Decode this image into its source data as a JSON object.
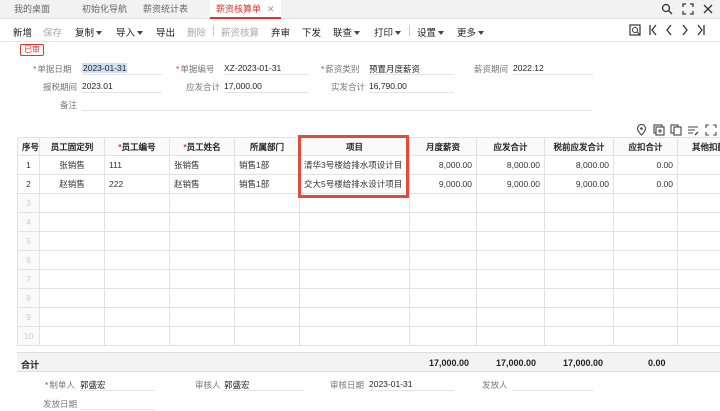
{
  "tabs": [
    {
      "label": "我的桌面"
    },
    {
      "label": "初始化导航"
    },
    {
      "label": "薪资统计表"
    },
    {
      "label": "薪资核算单"
    }
  ],
  "toolbar": {
    "add": "新增",
    "save": "保存",
    "copy": "复制",
    "import": "导入",
    "export": "导出",
    "delete": "删除",
    "calc": "薪资核算",
    "abandon": "弃审",
    "issue": "下发",
    "link": "联查",
    "print": "打印",
    "settings": "设置",
    "more": "更多"
  },
  "status_badge": "已审",
  "form": {
    "doc_date_label": "单据日期",
    "doc_date": "2023-01-31",
    "doc_no_label": "单据编号",
    "doc_no": "XZ-2023-01-31",
    "salary_type_label": "薪资类别",
    "salary_type": "预置月度薪资",
    "salary_period_label": "薪资期间",
    "salary_period": "2022.12",
    "tax_period_label": "报税期间",
    "tax_period": "2023.01",
    "gross_total_label": "应发合计",
    "gross_total": "17,000.00",
    "net_total_label": "实发合计",
    "net_total": "16,790.00",
    "remark_label": "备注"
  },
  "table": {
    "headers": [
      "序号",
      "员工固定列",
      "员工编号",
      "员工姓名",
      "所属部门",
      "项目",
      "月度薪资",
      "应发合计",
      "税前应发合计",
      "应扣合计",
      "其他扣款"
    ],
    "rows": [
      [
        "1",
        "张销售",
        "111",
        "张销售",
        "销售1部",
        "清华3号楼给排水项设计目",
        "8,000.00",
        "8,000.00",
        "8,000.00",
        "0.00",
        ""
      ],
      [
        "2",
        "赵销售",
        "222",
        "赵销售",
        "销售1部",
        "交大5号楼给排水设计项目",
        "9,000.00",
        "9,000.00",
        "9,000.00",
        "0.00",
        ""
      ]
    ],
    "empty_rows": [
      "3",
      "4",
      "5",
      "6",
      "7",
      "8",
      "9",
      "10"
    ],
    "total_label": "合计",
    "totals": {
      "monthly": "17,000.00",
      "gross": "17,000.00",
      "pretax": "17,000.00",
      "deduct": "0.00"
    }
  },
  "footer": {
    "maker_label": "制单人",
    "maker": "郭盛宏",
    "auditor_label": "审核人",
    "auditor": "郭盛宏",
    "audit_date_label": "审核日期",
    "audit_date": "2023-01-31",
    "issuer_label": "发放人",
    "issue_date_label": "发放日期"
  }
}
